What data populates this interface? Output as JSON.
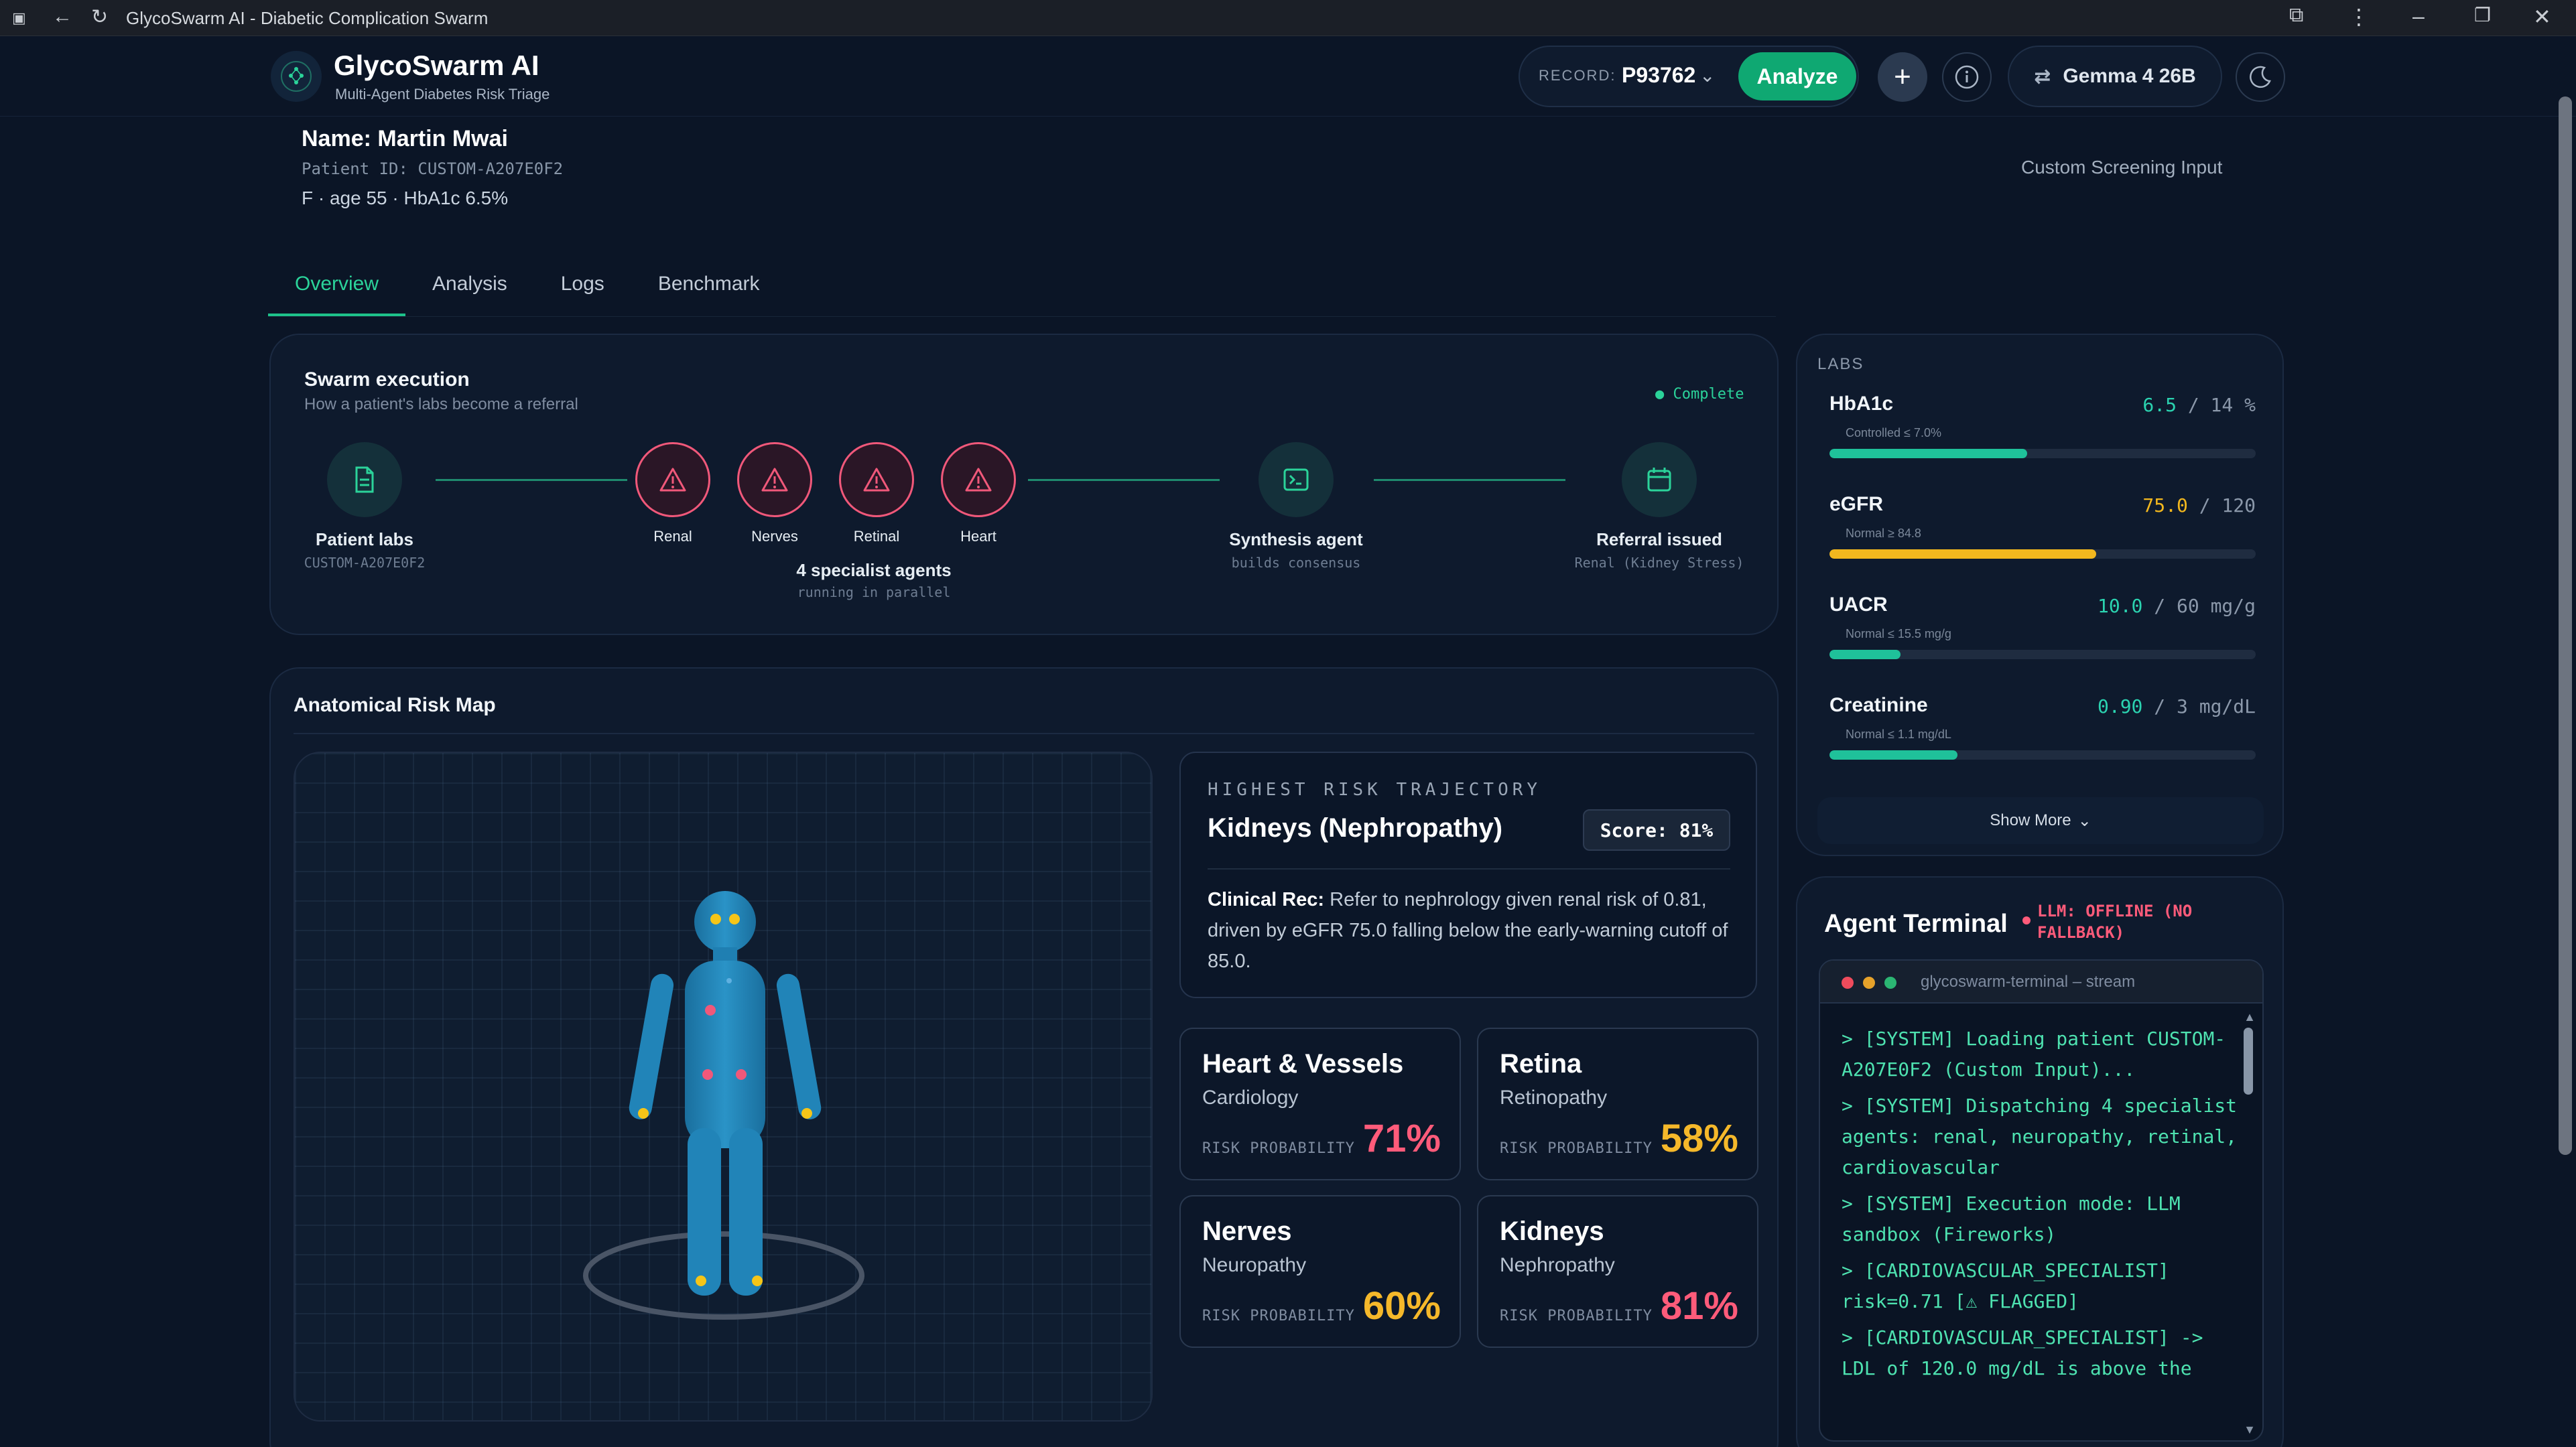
{
  "browser": {
    "tab_title": "GlycoSwarm AI - Diabetic Complication Swarm"
  },
  "app": {
    "title": "GlycoSwarm AI",
    "subtitle": "Multi-Agent Diabetes Risk Triage",
    "record_label": "RECORD:",
    "record_value": "P93762",
    "analyze_label": "Analyze",
    "model_label": "Gemma 4 26B"
  },
  "patient": {
    "name": "Name: Martin Mwai",
    "id": "Patient ID: CUSTOM-A207E0F2",
    "demographics": "F · age 55 · HbA1c 6.5%",
    "source": "Custom Screening Input"
  },
  "tabs": [
    {
      "label": "Overview",
      "active": true
    },
    {
      "label": "Analysis"
    },
    {
      "label": "Logs"
    },
    {
      "label": "Benchmark"
    }
  ],
  "swarm": {
    "title": "Swarm execution",
    "subtitle": "How a patient's labs become a referral",
    "status": "● Complete",
    "patient_labs": {
      "label": "Patient labs",
      "sub": "CUSTOM-A207E0F2"
    },
    "agents": [
      {
        "label": "Renal"
      },
      {
        "label": "Nerves"
      },
      {
        "label": "Retinal"
      },
      {
        "label": "Heart"
      }
    ],
    "agents_caption": "4 specialist agents",
    "agents_sub": "running in parallel",
    "synthesis": {
      "label": "Synthesis agent",
      "sub": "builds consensus"
    },
    "referral": {
      "label": "Referral issued",
      "sub": "Renal (Kidney Stress)"
    }
  },
  "labs": {
    "heading": "LABS",
    "items": [
      {
        "name": "HbA1c",
        "value": "6.5",
        "max": "/ 14 %",
        "normal": "Controlled ≤ 7.0%",
        "fraction": 0.464,
        "color": "#1fc19a"
      },
      {
        "name": "eGFR",
        "value": "75.0",
        "max": "/ 120",
        "normal": "Normal ≥ 84.8",
        "fraction": 0.625,
        "color": "#f2b71e"
      },
      {
        "name": "UACR",
        "value": "10.0",
        "max": "/ 60 mg/g",
        "normal": "Normal ≤ 15.5 mg/g",
        "fraction": 0.167,
        "color": "#1fc19a"
      },
      {
        "name": "Creatinine",
        "value": "0.90",
        "max": "/ 3 mg/dL",
        "normal": "Normal ≤ 1.1 mg/dL",
        "fraction": 0.3,
        "color": "#1fc19a"
      }
    ],
    "show_more": "Show More"
  },
  "anatomy": {
    "title": "Anatomical Risk Map",
    "trajectory_eyebrow": "HIGHEST RISK TRAJECTORY",
    "trajectory_title": "Kidneys (Nephropathy)",
    "score": "Score: 81%",
    "rec_label": "Clinical Rec:",
    "rec_text": "Refer to nephrology given renal risk of 0.81, driven by eGFR 75.0 falling below the early-warning cutoff of 85.0.",
    "risks": [
      {
        "name": "Heart & Vessels",
        "specialty": "Cardiology",
        "label": "RISK PROBABILITY",
        "pct": "71%",
        "color": "#ff5b7a"
      },
      {
        "name": "Retina",
        "specialty": "Retinopathy",
        "label": "RISK PROBABILITY",
        "pct": "58%",
        "color": "#f5b82a"
      },
      {
        "name": "Nerves",
        "specialty": "Neuropathy",
        "label": "RISK PROBABILITY",
        "pct": "60%",
        "color": "#f5b82a"
      },
      {
        "name": "Kidneys",
        "specialty": "Nephropathy",
        "label": "RISK PROBABILITY",
        "pct": "81%",
        "color": "#ff5b7a"
      }
    ]
  },
  "terminal": {
    "title": "Agent Terminal",
    "status": "LLM: OFFLINE (NO FALLBACK)",
    "window_title": "glycoswarm-terminal – stream",
    "lines": [
      "> [SYSTEM] Loading patient CUSTOM-A207E0F2 (Custom Input)...",
      "> [SYSTEM] Dispatching 4 specialist agents: renal, neuropathy, retinal, cardiovascular",
      "> [SYSTEM] Execution mode: LLM sandbox (Fireworks)",
      "> [CARDIOVASCULAR_SPECIALIST] risk=0.71 [⚠ FLAGGED]",
      "> [CARDIOVASCULAR_SPECIALIST] -> LDL of 120.0 mg/dL is above the"
    ]
  },
  "colors": {
    "accent": "#0fa872",
    "danger": "#ff5b7a",
    "warning": "#f5b82a",
    "background": "#0b1526"
  }
}
